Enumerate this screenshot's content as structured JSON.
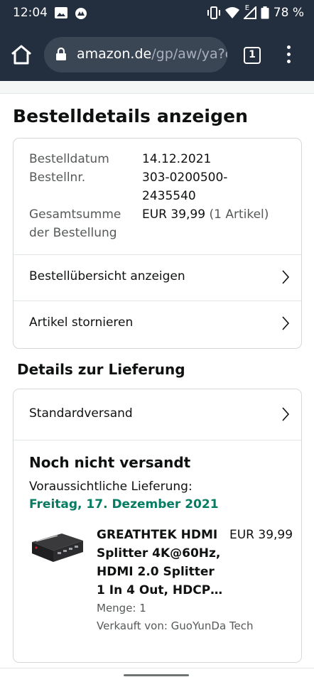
{
  "status_bar": {
    "time": "12:04",
    "battery": "78 %",
    "signal_badge": "E",
    "icons": [
      "image-icon",
      "sync-app-icon",
      "vibrate-icon",
      "wifi-icon",
      "signal-icon",
      "battery-icon"
    ]
  },
  "browser": {
    "url_host": "amazon.de",
    "url_path": "/gp/aw/ya?c",
    "tab_count": "1",
    "icons": [
      "home-icon",
      "lock-icon",
      "more-vert-icon"
    ]
  },
  "page": {
    "title": "Bestelldetails anzeigen",
    "order": {
      "date_label": "Bestelldatum",
      "date_value": "14.12.2021",
      "number_label": "Bestellnr.",
      "number_value_1": "303-0200500-",
      "number_value_2": "2435540",
      "total_label_1": "Gesamtsumme",
      "total_label_2": "der Bestellung",
      "total_value": "EUR 39,99",
      "total_count": "(1 Artikel)"
    },
    "links": {
      "overview": "Bestellübersicht anzeigen",
      "cancel": "Artikel stornieren"
    },
    "delivery": {
      "section_title": "Details zur Lieferung",
      "shipping_method": "Standardversand",
      "status": "Noch nicht versandt",
      "expected_label": "Voraussichtliche Lieferung:",
      "expected_date": "Freitag, 17. Dezember 2021"
    },
    "product": {
      "title": "GREATHTEK HDMI Splitter 4K@60Hz, HDMI 2.0 Splitter 1 In 4 Out, HDCP…",
      "price": "EUR 39,99",
      "quantity": "Menge: 1",
      "seller": "Verkauft von: GuoYunDa Tech"
    }
  },
  "colors": {
    "header_bg": "#232f3e",
    "delivery_green": "#067d62",
    "muted_text": "#565959",
    "border": "#d5d9d9"
  }
}
